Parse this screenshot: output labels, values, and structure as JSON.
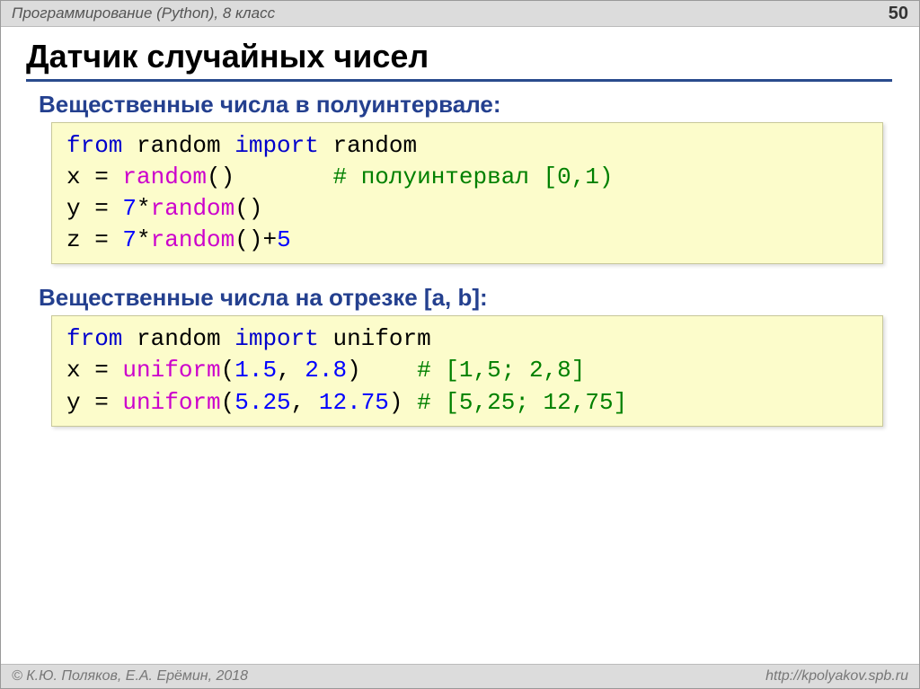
{
  "header": {
    "course_title": "Программирование (Python), 8 класс",
    "page_number": "50"
  },
  "heading": "Датчик случайных чисел",
  "sections": {
    "s1_label": "Вещественные числа в полуинтервале:",
    "s2_label": "Вещественные числа на отрезке [a, b]:"
  },
  "code1": {
    "l1": {
      "kw1": "from",
      "mod": " random ",
      "kw2": "import",
      "imp": " random"
    },
    "l2": {
      "pre": "x = ",
      "fn": "random",
      "post": "()       ",
      "cmt": "# полуинтервал [0,1)"
    },
    "l3": {
      "pre": "y = ",
      "n1": "7",
      "star": "*",
      "fn": "random",
      "post": "()"
    },
    "l4": {
      "pre": "z = ",
      "n1": "7",
      "star": "*",
      "fn": "random",
      "post": "()+",
      "n2": "5"
    }
  },
  "code2": {
    "l1": {
      "kw1": "from",
      "mod": " random ",
      "kw2": "import",
      "imp": " uniform"
    },
    "l2": {
      "pre": "x = ",
      "fn": "uniform",
      "open": "(",
      "a1": "1.5",
      "comma": ", ",
      "a2": "2.8",
      "close": ")",
      "pad": "    ",
      "cmt": "# [1,5; 2,8]"
    },
    "l3": {
      "pre": "y = ",
      "fn": "uniform",
      "open": "(",
      "a1": "5.25",
      "comma": ", ",
      "a2": "12.75",
      "close": ")",
      "pad": " ",
      "cmt": "# [5,25; 12,75]"
    }
  },
  "footer": {
    "copyright": "© К.Ю. Поляков, Е.А. Ерёмин, 2018",
    "url": "http://kpolyakov.spb.ru"
  }
}
